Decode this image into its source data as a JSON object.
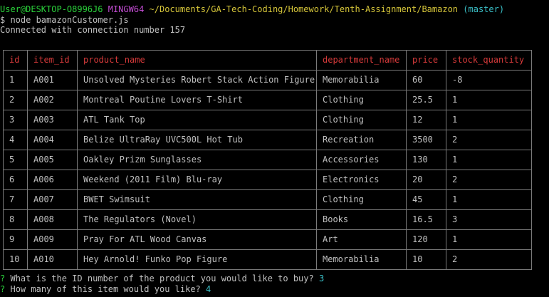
{
  "prompt": {
    "user_host": "User@DESKTOP-O8996J6",
    "shell": "MINGW64",
    "path": "~/Documents/GA-Tech-Coding/Homework/Tenth-Assignment/Bamazon",
    "branch": "(master)"
  },
  "command": "$ node bamazonCustomer.js",
  "connection_message": "Connected with connection number 157",
  "table": {
    "headers": [
      "id",
      "item_id",
      "product_name",
      "department_name",
      "price",
      "stock_quantity"
    ],
    "rows": [
      [
        "1",
        "A001",
        "Unsolved Mysteries Robert Stack Action Figure",
        "Memorabilia",
        "60",
        "-8"
      ],
      [
        "2",
        "A002",
        "Montreal Poutine Lovers T-Shirt",
        "Clothing",
        "25.5",
        "1"
      ],
      [
        "3",
        "A003",
        "ATL Tank Top",
        "Clothing",
        "12",
        "1"
      ],
      [
        "4",
        "A004",
        "Belize UltraRay UVC500L Hot Tub",
        "Recreation",
        "3500",
        "2"
      ],
      [
        "5",
        "A005",
        "Oakley Prizm Sunglasses",
        "Accessories",
        "130",
        "1"
      ],
      [
        "6",
        "A006",
        "Weekend (2011 Film) Blu-ray",
        "Electronics",
        "20",
        "2"
      ],
      [
        "7",
        "A007",
        "BWET Swimsuit",
        "Clothing",
        "45",
        "1"
      ],
      [
        "8",
        "A008",
        "The Regulators (Novel)",
        "Books",
        "16.5",
        "3"
      ],
      [
        "9",
        "A009",
        "Pray For ATL Wood Canvas",
        "Art",
        "120",
        "1"
      ],
      [
        "10",
        "A010",
        "Hey Arnold! Funko Pop Figure",
        "Memorabilia",
        "10",
        "2"
      ]
    ]
  },
  "questions": [
    {
      "mark": "?",
      "text": "What is the ID number of the product you would like to buy?",
      "answer": "3"
    },
    {
      "mark": "?",
      "text": "How many of this item would you like?",
      "answer": "4"
    }
  ],
  "colors": {
    "background": "#000000",
    "text": "#c0c0c0",
    "user_host": "#2bd23b",
    "shell": "#c04bd0",
    "path": "#d6c63a",
    "branch": "#3ac0c8",
    "table_header": "#d63a3a",
    "table_border": "#7a7a7a"
  }
}
